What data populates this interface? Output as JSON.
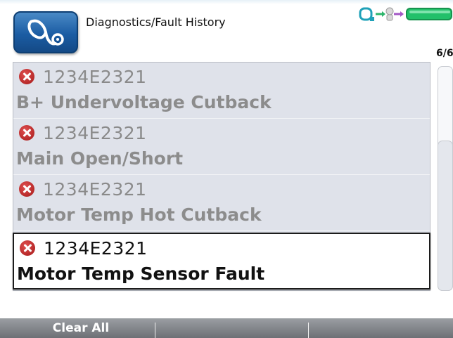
{
  "header": {
    "title": "Diagnostics/Fault History",
    "page_counter": "6/6",
    "app_icon": "stethoscope-icon",
    "status_icons": [
      "connection-icon",
      "people-icon",
      "battery-icon"
    ]
  },
  "faults": [
    {
      "code": "1234E2321",
      "name": "B+ Undervoltage Cutback",
      "selected": false,
      "icon": "error-icon"
    },
    {
      "code": "1234E2321",
      "name": "Main Open/Short",
      "selected": false,
      "icon": "error-icon"
    },
    {
      "code": "1234E2321",
      "name": "Motor Temp Hot Cutback",
      "selected": false,
      "icon": "error-icon"
    },
    {
      "code": "1234E2321",
      "name": "Motor Temp Sensor Fault",
      "selected": true,
      "icon": "error-icon"
    }
  ],
  "softkeys": {
    "left": "Clear All",
    "middle": "",
    "right": ""
  },
  "colors": {
    "error": "#c0282d",
    "accent": "#1b5ca3",
    "list_bg": "#dfe2ea",
    "status_green": "#22c06a"
  }
}
